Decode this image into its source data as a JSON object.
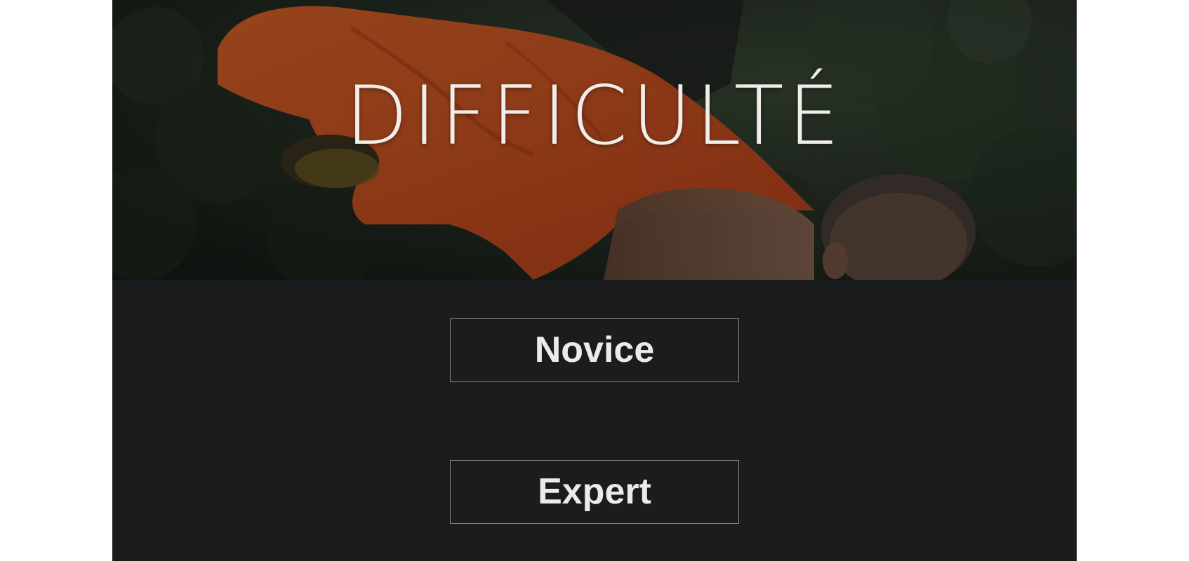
{
  "screen": {
    "title": "DIFFICULTÉ",
    "hero_image": "photo of a monk in orange robe balancing on one hand"
  },
  "difficulty": {
    "options": [
      {
        "label": "Novice"
      },
      {
        "label": "Expert"
      }
    ]
  },
  "colors": {
    "background": "#1b1c1e",
    "button_border": "#8a8374",
    "text": "#eeebe6",
    "robe_accent": "#e5541f"
  }
}
